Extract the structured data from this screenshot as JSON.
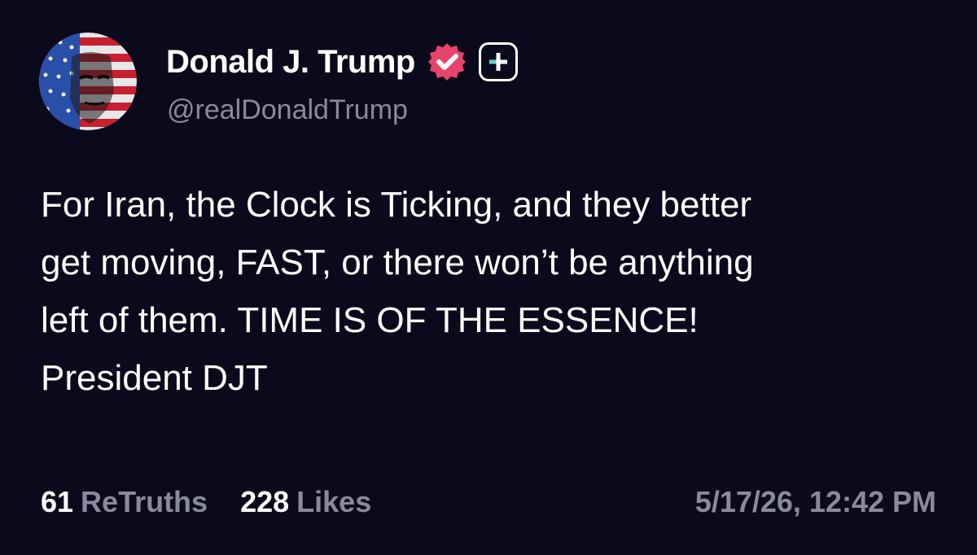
{
  "post": {
    "author": {
      "display_name": "Donald J. Trump",
      "handle": "@realDonaldTrump",
      "verified_icon": "verified-badge-icon",
      "plus_icon": "plus-badge-icon"
    },
    "body_lines": [
      "For Iran, the Clock is Ticking, and they better",
      "get moving, FAST, or there won’t be anything",
      "left of them. TIME IS OF THE ESSENCE!",
      "President DJT"
    ],
    "stats": {
      "retruths_count": "61",
      "retruths_label": "ReTruths",
      "likes_count": "228",
      "likes_label": "Likes"
    },
    "timestamp": "5/17/26, 12:42 PM"
  },
  "colors": {
    "background": "#0b0a1c",
    "text_primary": "#ffffff",
    "text_secondary": "#8a8a9e",
    "verified_badge": "#e8436b",
    "plus_accent": "#5fd3d0"
  }
}
